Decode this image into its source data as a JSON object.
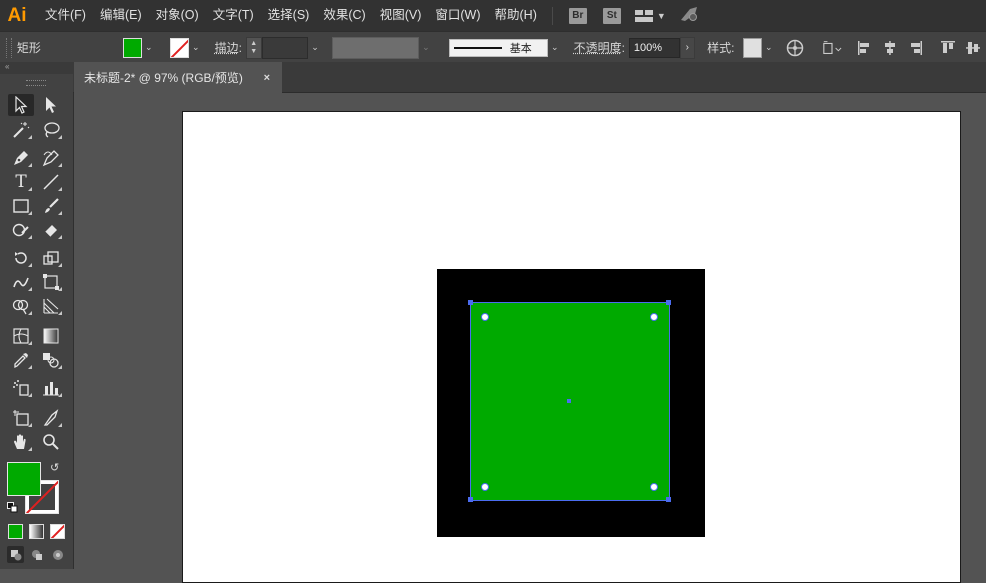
{
  "app": {
    "logo": "Ai"
  },
  "menu": {
    "items": [
      "文件(F)",
      "编辑(E)",
      "对象(O)",
      "文字(T)",
      "选择(S)",
      "效果(C)",
      "视图(V)",
      "窗口(W)",
      "帮助(H)"
    ],
    "bridge": "Br",
    "stock": "St"
  },
  "control": {
    "tool_name": "矩形",
    "stroke_label": "描边",
    "stroke_style": "基本",
    "opacity_label": "不透明度",
    "opacity_value": "100%",
    "style_label": "样式"
  },
  "document": {
    "tab_title": "未标题-2* @ 97% (RGB/预览)",
    "close": "×"
  },
  "colors": {
    "fill": "#00aa00",
    "stroke_none": "#e02020",
    "selection": "#4b6cf0",
    "rect_back": "#000000"
  }
}
